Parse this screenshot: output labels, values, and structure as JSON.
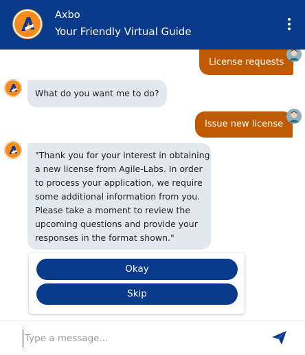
{
  "header": {
    "name": "Axbo",
    "tagline": "Your Friendly Virtual Guide"
  },
  "messages": {
    "user_1": "License requests",
    "bot_1": "What do you want me to do?",
    "user_2": "Issue new license",
    "bot_2_lines": [
      "\"Thank you for your interest in obtaining",
      "a new license from Agile-Labs. In order",
      "to process your application, we require",
      "some additional information from you.",
      "Please take a moment to review the",
      "upcoming questions and provide your",
      "responses in the format shown.\""
    ]
  },
  "options": {
    "okay": "Okay",
    "skip": "Skip"
  },
  "composer": {
    "placeholder": "Type a message..."
  },
  "colors": {
    "header_bg": "#0a3a8c",
    "user_bubble": "#c05a00",
    "bot_bubble": "#e3e7ee",
    "brand_orange": "#f58a1f"
  }
}
